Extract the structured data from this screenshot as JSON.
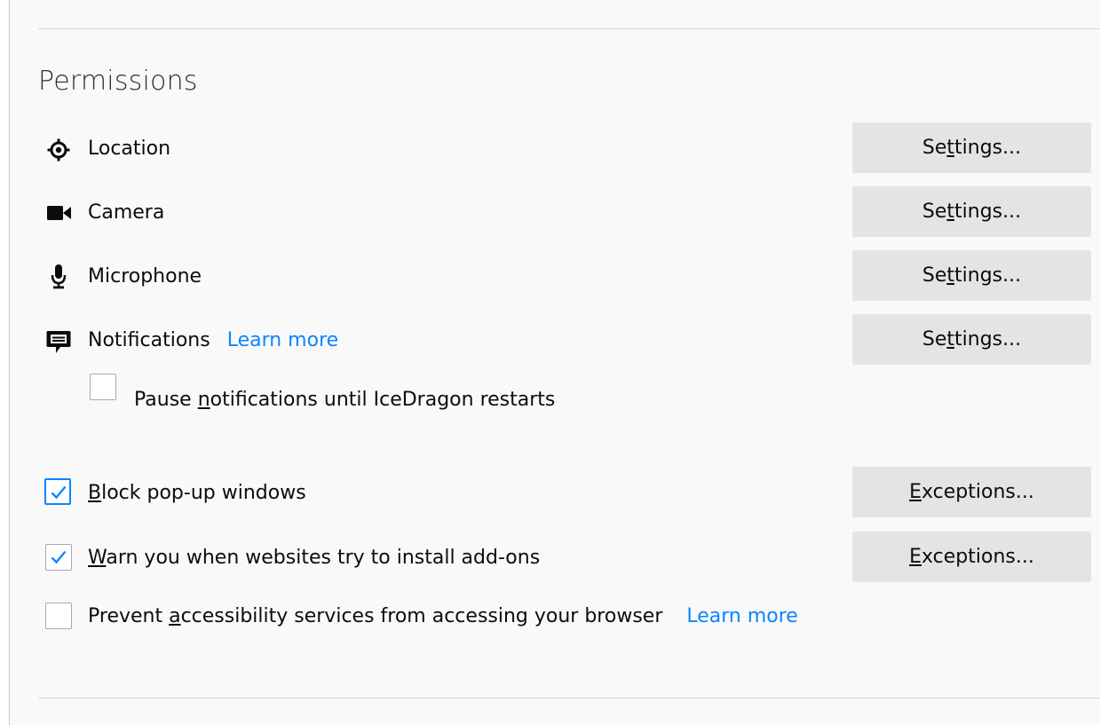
{
  "section": {
    "heading": "Permissions"
  },
  "permissions": [
    {
      "label": "Location",
      "icon": "location-icon",
      "button": {
        "pre": "Se",
        "mn": "t",
        "post": "tings..."
      }
    },
    {
      "label": "Camera",
      "icon": "camera-icon",
      "button": {
        "pre": "Se",
        "mn": "t",
        "post": "tings..."
      }
    },
    {
      "label": "Microphone",
      "icon": "microphone-icon",
      "button": {
        "pre": "Se",
        "mn": "t",
        "post": "tings..."
      }
    },
    {
      "label": "Notifications",
      "icon": "notification-icon",
      "learn_more": "Learn more",
      "button": {
        "pre": "Se",
        "mn": "t",
        "post": "tings..."
      }
    }
  ],
  "pause_notifications": {
    "pre": "Pause ",
    "mn": "n",
    "post": "otifications until IceDragon restarts",
    "checked": false
  },
  "block_popups": {
    "pre": "",
    "mn": "B",
    "post": "lock pop-up windows",
    "checked": true,
    "button": {
      "pre": "",
      "mn": "E",
      "post": "xceptions..."
    }
  },
  "warn_addons": {
    "pre": "",
    "mn": "W",
    "post": "arn you when websites try to install add-ons",
    "checked": true,
    "button": {
      "pre": "",
      "mn": "E",
      "post": "xceptions..."
    }
  },
  "prevent_a11y": {
    "pre": "Prevent ",
    "mn": "a",
    "post": "ccessibility services from accessing your browser",
    "learn_more": "Learn more",
    "checked": false
  },
  "colors": {
    "accent": "#0a84ff",
    "button_bg": "#e4e4e6",
    "panel_bg": "#f9f9fa"
  }
}
